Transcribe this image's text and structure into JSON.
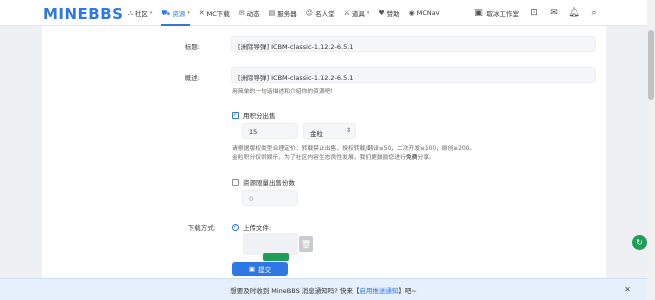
{
  "header": {
    "logo": "MINEBBS",
    "nav": [
      {
        "icon": "users-icon",
        "glyph": "⛬",
        "label": "社区",
        "caret": true,
        "active": false
      },
      {
        "icon": "cart-icon",
        "glyph": "⛟",
        "label": "资源",
        "caret": true,
        "active": true
      },
      {
        "icon": "close-icon",
        "glyph": "✕",
        "label": "MC下载",
        "caret": false,
        "active": false
      },
      {
        "icon": "comment-icon",
        "glyph": "✉",
        "label": "动态",
        "caret": false,
        "active": false
      },
      {
        "icon": "server-icon",
        "glyph": "▤",
        "label": "服务器",
        "caret": false,
        "active": false
      },
      {
        "icon": "person-icon",
        "glyph": "☺",
        "label": "名人堂",
        "caret": false,
        "active": false
      },
      {
        "icon": "sword-icon",
        "glyph": "⚔",
        "label": "道具",
        "caret": true,
        "active": false
      },
      {
        "icon": "donate-icon",
        "glyph": "♥",
        "label": "赞助",
        "caret": false,
        "active": false
      },
      {
        "icon": "mcnav-icon",
        "glyph": "◉",
        "label": "MCNav",
        "caret": false,
        "active": false
      }
    ],
    "workbench": "取冰工作室"
  },
  "form": {
    "title_label": "标题:",
    "title_value": "[洲际导弹] ICBM-classic-1.12.2-6.5.1",
    "summary_label": "概述:",
    "summary_value": "[洲际导弹] ICBM-classic-1.12.2-6.5.1",
    "summary_hint": "用简单的一句话描述和介绍你的资源吧!",
    "sell_checkbox": "用积分出售",
    "price_value": "15",
    "currency_value": "金粒",
    "price_hint_1": "请根据版权类型合理定价：转载禁止出售，授权转载/翻译≤50，二次开发≤100，原创≥200。",
    "price_hint_2_a": "金粒积分仅供娱乐，为了社区内容生态良性发展，我们更鼓励您进行",
    "price_hint_2_bold": "免费",
    "price_hint_2_b": "分享。",
    "limit_checkbox": "资源限量出售份数",
    "limit_value": "0",
    "download_label": "下载方式:",
    "upload_radio": "上传文件:",
    "submit_label": "提交"
  },
  "notice": {
    "text_a": "想要及时收到 MineBBS 消息通知吗? 快来【",
    "link": "启用推送通知",
    "text_b": "】吧~"
  }
}
